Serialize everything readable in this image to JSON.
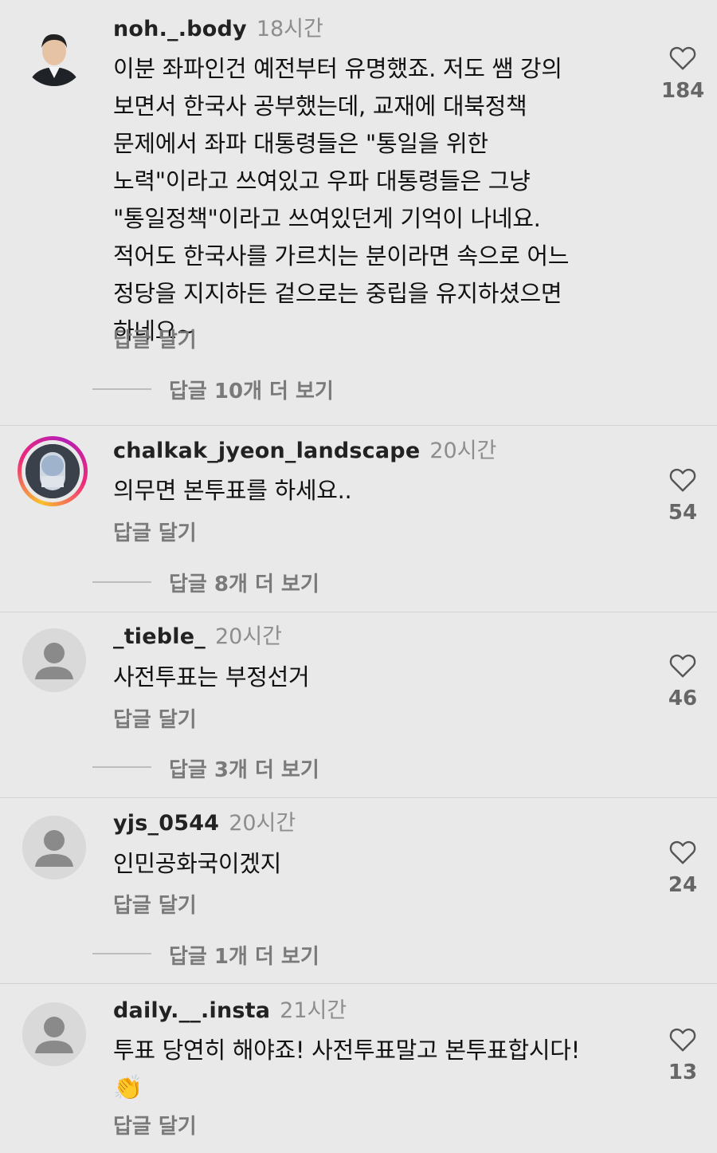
{
  "comments": [
    {
      "username": "noh._.body",
      "time": "18시간",
      "text": "이분 좌파인건 예전부터 유명했죠. 저도 쌤 강의\n보면서 한국사 공부했는데, 교재에 대북정책\n문제에서 좌파 대통령들은 \"통일을 위한\n노력\"이라고 쓰여있고 우파 대통령들은 그냥\n\"통일정책\"이라고 쓰여있던게 기억이 나네요.\n적어도 한국사를 가르치는 분이라면 속으로 어느\n정당을 지지하든 겉으로는 중립을 유지하셨으면\n하네요~",
      "reply_label": "답글 달기",
      "more_label": "답글 10개 더 보기",
      "likes": "184",
      "avatar_icon": "person-photo-avatar"
    },
    {
      "username": "chalkak_jyeon_landscape",
      "time": "20시간",
      "text": "의무면 본투표를 하세요..",
      "reply_label": "답글 달기",
      "more_label": "답글 8개 더 보기",
      "likes": "54",
      "avatar_icon": "airplane-window-avatar"
    },
    {
      "username": "_tieble_",
      "time": "20시간",
      "text": "사전투표는 부정선거",
      "reply_label": "답글 달기",
      "more_label": "답글 3개 더 보기",
      "likes": "46",
      "avatar_icon": "default-person-avatar"
    },
    {
      "username": "yjs_0544",
      "time": "20시간",
      "text": "인민공화국이겠지",
      "reply_label": "답글 달기",
      "more_label": "답글 1개 더 보기",
      "likes": "24",
      "avatar_icon": "default-person-avatar"
    },
    {
      "username": "daily.__.insta",
      "time": "21시간",
      "text": "투표 당연히 해야죠! 사전투표말고 본투표합시다!",
      "emoji": "👏",
      "reply_label": "답글 달기",
      "likes": "13",
      "avatar_icon": "default-person-avatar"
    }
  ],
  "colors": {
    "background": "#e9e9e9",
    "username": "#222222",
    "muted": "#8d8d8d"
  }
}
